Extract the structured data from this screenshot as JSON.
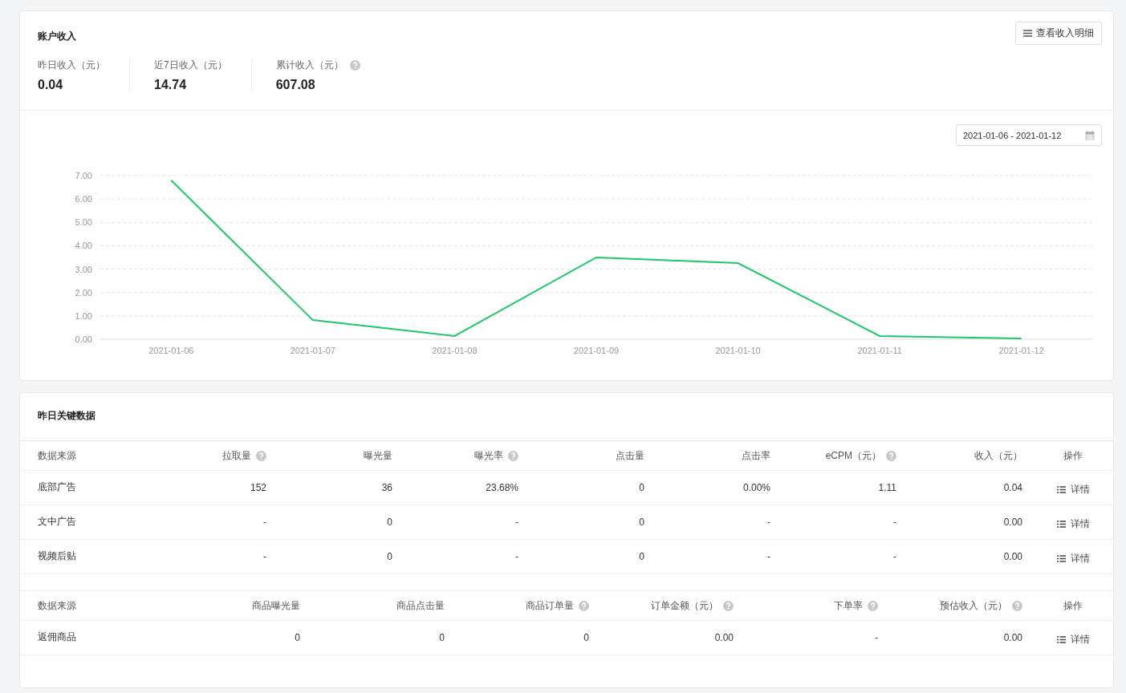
{
  "account_income": {
    "title": "账户收入",
    "detail_button": "查看收入明细",
    "stats": [
      {
        "label": "昨日收入（元）",
        "value": "0.04",
        "help": false
      },
      {
        "label": "近7日收入（元）",
        "value": "14.74",
        "help": false
      },
      {
        "label": "累计收入（元）",
        "value": "607.08",
        "help": true
      }
    ]
  },
  "income_chart": {
    "date_range": "2021-01-06 - 2021-01-12",
    "chart_data": {
      "type": "line",
      "grid": true,
      "categories": [
        "2021-01-06",
        "2021-01-07",
        "2021-01-08",
        "2021-01-09",
        "2021-01-10",
        "2021-01-11",
        "2021-01-12"
      ],
      "ylim": [
        0,
        7
      ],
      "yticks": [
        {
          "value": 0,
          "label": "0.00"
        },
        {
          "value": 1,
          "label": "1.00"
        },
        {
          "value": 2,
          "label": "2.00"
        },
        {
          "value": 3,
          "label": "3.00"
        },
        {
          "value": 4,
          "label": "4.00"
        },
        {
          "value": 5,
          "label": "5.00"
        },
        {
          "value": 6,
          "label": "6.00"
        },
        {
          "value": 7,
          "label": "7.00"
        }
      ],
      "series": [
        {
          "color": "#1ec86a",
          "values": [
            6.8,
            0.82,
            0.14,
            3.5,
            3.26,
            0.14,
            0.03
          ]
        }
      ]
    }
  },
  "key_data": {
    "title": "昨日关键数据",
    "tables": [
      {
        "columns": [
          {
            "label": "数据来源",
            "help": false
          },
          {
            "label": "拉取量",
            "help": true
          },
          {
            "label": "曝光量",
            "help": false
          },
          {
            "label": "曝光率",
            "help": true
          },
          {
            "label": "点击量",
            "help": false
          },
          {
            "label": "点击率",
            "help": false
          },
          {
            "label": "eCPM（元）",
            "help": true
          },
          {
            "label": "收入（元）",
            "help": false
          },
          {
            "label": "操作",
            "help": false
          }
        ],
        "rows": [
          {
            "cells": [
              "底部广告",
              "152",
              "36",
              "23.68%",
              "0",
              "0.00%",
              "1.11",
              "0.04"
            ],
            "action": "详情"
          },
          {
            "cells": [
              "文中广告",
              "-",
              "0",
              "-",
              "0",
              "-",
              "-",
              "0.00"
            ],
            "action": "详情"
          },
          {
            "cells": [
              "视频后贴",
              "-",
              "0",
              "-",
              "0",
              "-",
              "-",
              "0.00"
            ],
            "action": "详情"
          }
        ]
      },
      {
        "columns": [
          {
            "label": "数据来源",
            "help": false
          },
          {
            "label": "商品曝光量",
            "help": false
          },
          {
            "label": "商品点击量",
            "help": false
          },
          {
            "label": "商品订单量",
            "help": true
          },
          {
            "label": "订单金额（元）",
            "help": true
          },
          {
            "label": "下单率",
            "help": true
          },
          {
            "label": "预估收入（元）",
            "help": true
          },
          {
            "label": "操作",
            "help": false
          }
        ],
        "rows": [
          {
            "cells": [
              "返佣商品",
              "0",
              "0",
              "0",
              "0.00",
              "-",
              "0.00"
            ],
            "action": "详情"
          }
        ]
      }
    ]
  }
}
